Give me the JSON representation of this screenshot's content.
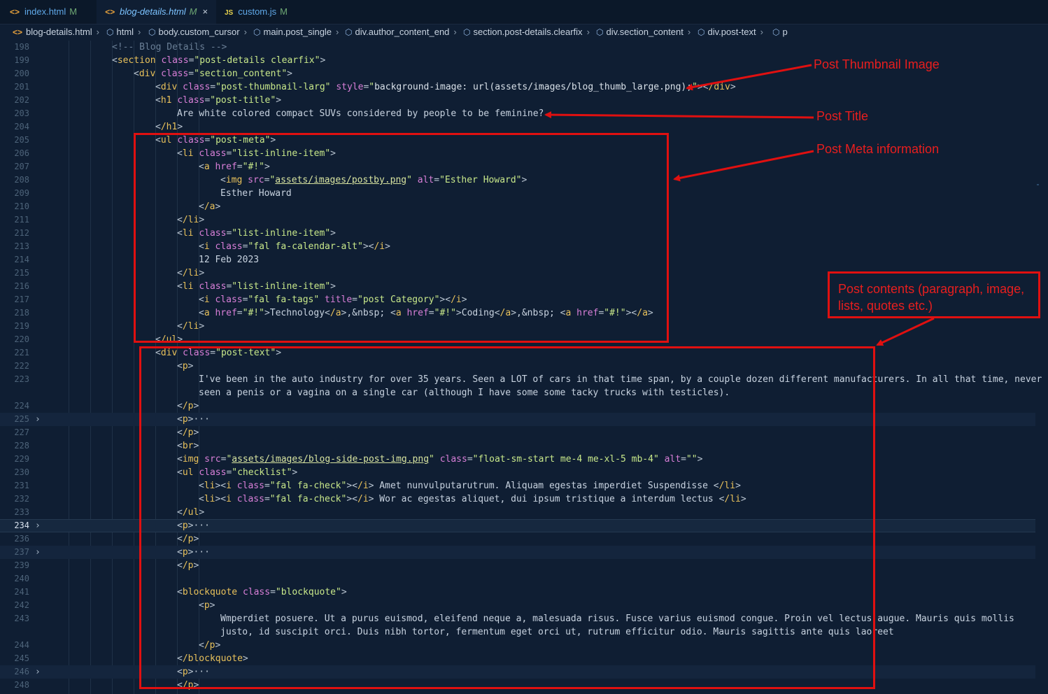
{
  "tabs": [
    {
      "icon": "<>",
      "label": "index.html",
      "mod": "M",
      "active": false
    },
    {
      "icon": "<>",
      "label": "blog-details.html",
      "mod": "M",
      "active": true,
      "close": "×"
    },
    {
      "icon": "JS",
      "label": "custom.js",
      "mod": "M",
      "active": false
    }
  ],
  "breadcrumb": [
    "blog-details.html",
    "html",
    "body.custom_cursor",
    "main.post_single",
    "div.author_content_end",
    "section.post-details.clearfix",
    "div.section_content",
    "div.post-text",
    "p"
  ],
  "line_numbers": [
    "198",
    "199",
    "200",
    "201",
    "202",
    "203",
    "204",
    "205",
    "206",
    "207",
    "208",
    "209",
    "210",
    "211",
    "212",
    "213",
    "214",
    "215",
    "216",
    "217",
    "218",
    "219",
    "220",
    "221",
    "222",
    "223",
    "",
    "224",
    "225",
    "227",
    "228",
    "229",
    "230",
    "231",
    "232",
    "233",
    "234",
    "236",
    "237",
    "239",
    "240",
    "241",
    "242",
    "243",
    "",
    "244",
    "245",
    "246",
    "248"
  ],
  "code": {
    "l198": "<!-- Blog Details -->",
    "l199_tag": "section",
    "l199_attr": "class",
    "l199_val": "post-details clearfix",
    "l200_tag": "div",
    "l200_attr": "class",
    "l200_val": "section_content",
    "l201_tag": "div",
    "l201_attr": "class",
    "l201_val": "post-thumbnail-larg",
    "l201_attr2": "style",
    "l201_val2": "background-image: url(assets/images/blog_thumb_large.png);",
    "l202_tag": "h1",
    "l202_attr": "class",
    "l202_val": "post-title",
    "l203_text": "Are white colored compact SUVs considered by people to be feminine?",
    "l204_tag": "/h1",
    "l205_tag": "ul",
    "l205_attr": "class",
    "l205_val": "post-meta",
    "li_tag": "li",
    "li_attr": "class",
    "li_val": "list-inline-item",
    "a_tag": "a",
    "href_attr": "href",
    "href_val": "#!",
    "l208_tag": "img",
    "l208_src": "src",
    "l208_src_val": "assets/images/postby.png",
    "l208_alt": "alt",
    "l208_alt_val": "Esther Howard",
    "l209_text": "Esther Howard",
    "l210_tag": "/a",
    "li_close": "/li",
    "i_tag": "i",
    "i_attr": "class",
    "l213_val": "fal fa-calendar-alt",
    "i_close": "/i",
    "l214_text": "12 Feb 2023",
    "l217_val": "fal fa-tags",
    "l217_title": "title",
    "l217_title_val": "post Category",
    "l218_text1": "Technology",
    "l218_nbsp": ",&nbsp; ",
    "l218_text2": "Coding",
    "l220_tag": "/ul",
    "l221_tag": "div",
    "l221_attr": "class",
    "l221_val": "post-text",
    "p_tag": "p",
    "p_close": "/p",
    "ellipsis": "···",
    "l223_text": "I've been in the auto industry for over 35 years. Seen a LOT of cars in that time span, by a couple dozen different manufacturers. In all that time, never",
    "l223b_text": "seen a penis or a vagina on a single car (although I have some some tacky trucks with testicles).",
    "br_tag": "br",
    "l229_src_val": "assets/images/blog-side-post-img.png",
    "l229_class": "class",
    "l229_class_val": "float-sm-start me-4 me-xl-5 mb-4",
    "l229_alt_val": "",
    "l230_val": "checklist",
    "li_open": "li",
    "l231_ival": "fal fa-check",
    "l231_text": " Amet nunvulputarutrum. Aliquam egestas imperdiet Suspendisse ",
    "l232_text": " Wor ac egestas aliquet, dui ipsum tristique a interdum lectus ",
    "bq_tag": "blockquote",
    "bq_val": "blockquote",
    "l243_text": "Wmperdiet posuere. Ut a purus euismod, eleifend neque a, malesuada risus. Fusce varius euismod congue. Proin vel lectus augue. Mauris quis mollis",
    "l243b_text": "justo, id suscipit orci. Duis nibh tortor, fermentum eget orci ut, rutrum efficitur odio. Mauris sagittis ante quis laoreet",
    "bq_close": "/blockquote"
  },
  "annotations": {
    "thumbnail": "Post Thumbnail Image",
    "title": "Post Title",
    "meta": "Post Meta information",
    "contents_line1": "Post contents (paragraph, image,",
    "contents_line2": "lists, quotes etc.)"
  },
  "colors": {
    "annotation": "#e01010",
    "background": "#0f1e33",
    "tag": "#e8c15b",
    "attribute": "#d97fd8",
    "string": "#c8e88a"
  }
}
